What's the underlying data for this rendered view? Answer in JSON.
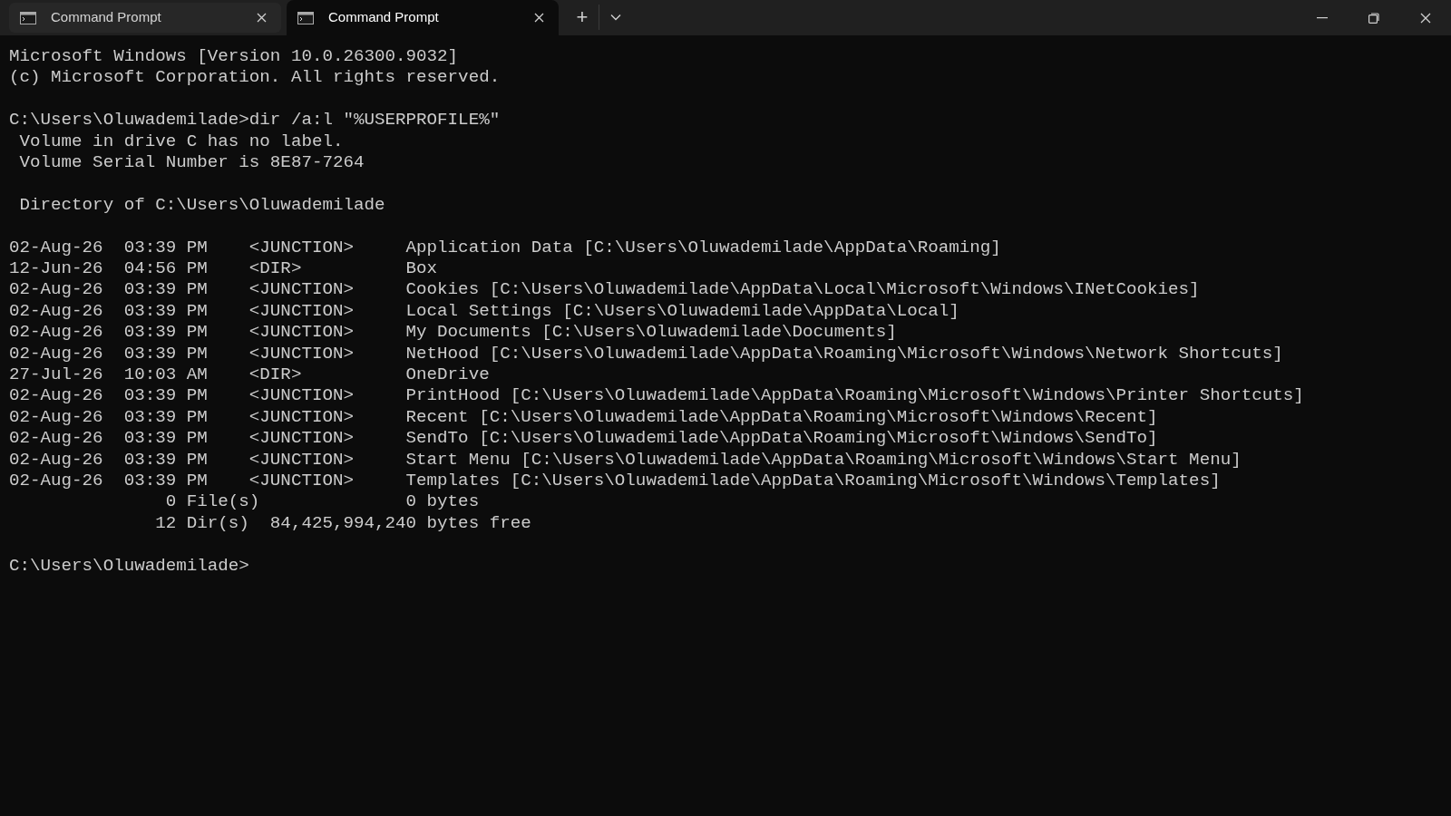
{
  "tabs": [
    {
      "title": "Command Prompt",
      "selected": false
    },
    {
      "title": "Command Prompt",
      "selected": true
    }
  ],
  "new_tab_button": "+",
  "console_blocks": [
    [
      "Microsoft Windows [Version 10.0.26300.9032]",
      "(c) Microsoft Corporation. All rights reserved."
    ],
    [
      "C:\\Users\\Oluwademilade>dir /a:l \"%USERPROFILE%\"",
      " Volume in drive C has no label.",
      " Volume Serial Number is 8E87-7264"
    ],
    [
      " Directory of C:\\Users\\Oluwademilade"
    ],
    [
      "02-Aug-26  03:39 PM    <JUNCTION>     Application Data [C:\\Users\\Oluwademilade\\AppData\\Roaming]",
      "12-Jun-26  04:56 PM    <DIR>          Box",
      "02-Aug-26  03:39 PM    <JUNCTION>     Cookies [C:\\Users\\Oluwademilade\\AppData\\Local\\Microsoft\\Windows\\INetCookies]",
      "02-Aug-26  03:39 PM    <JUNCTION>     Local Settings [C:\\Users\\Oluwademilade\\AppData\\Local]",
      "02-Aug-26  03:39 PM    <JUNCTION>     My Documents [C:\\Users\\Oluwademilade\\Documents]",
      "02-Aug-26  03:39 PM    <JUNCTION>     NetHood [C:\\Users\\Oluwademilade\\AppData\\Roaming\\Microsoft\\Windows\\Network Shortcuts]",
      "27-Jul-26  10:03 AM    <DIR>          OneDrive",
      "02-Aug-26  03:39 PM    <JUNCTION>     PrintHood [C:\\Users\\Oluwademilade\\AppData\\Roaming\\Microsoft\\Windows\\Printer Shortcuts]",
      "02-Aug-26  03:39 PM    <JUNCTION>     Recent [C:\\Users\\Oluwademilade\\AppData\\Roaming\\Microsoft\\Windows\\Recent]",
      "02-Aug-26  03:39 PM    <JUNCTION>     SendTo [C:\\Users\\Oluwademilade\\AppData\\Roaming\\Microsoft\\Windows\\SendTo]",
      "02-Aug-26  03:39 PM    <JUNCTION>     Start Menu [C:\\Users\\Oluwademilade\\AppData\\Roaming\\Microsoft\\Windows\\Start Menu]",
      "02-Aug-26  03:39 PM    <JUNCTION>     Templates [C:\\Users\\Oluwademilade\\AppData\\Roaming\\Microsoft\\Windows\\Templates]",
      "               0 File(s)              0 bytes",
      "              12 Dir(s)  84,425,994,240 bytes free"
    ],
    [
      "C:\\Users\\Oluwademilade>"
    ]
  ]
}
